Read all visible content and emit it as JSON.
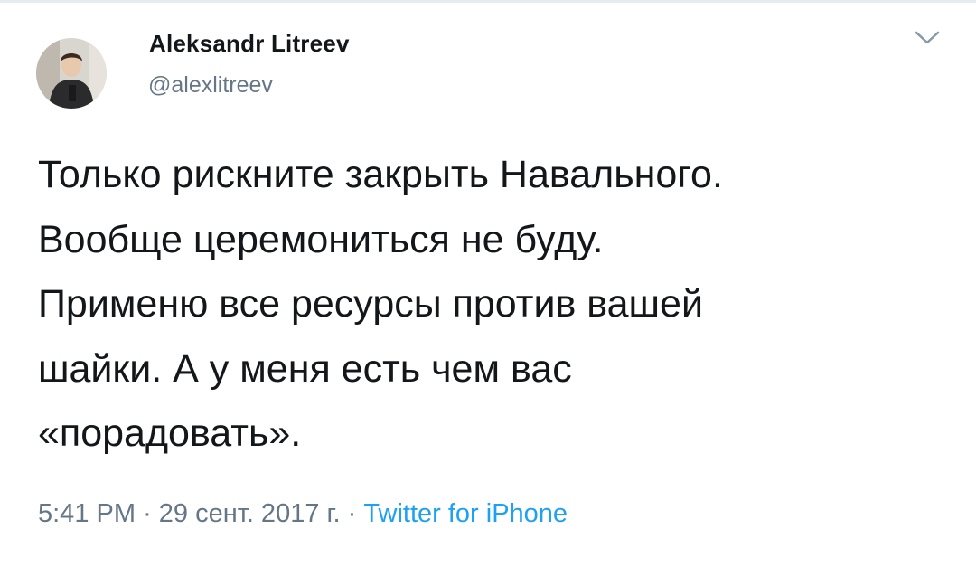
{
  "author": {
    "display_name": "Aleksandr Litreev",
    "handle": "@alexlitreev"
  },
  "tweet": {
    "text": "Только рискните закрыть Навального.\nВообще церемониться не буду.\nПрименю все ресурсы против вашей\nшайки. А у меня есть чем вас\n«порадовать».",
    "time": "5:41 PM",
    "separator1": "·",
    "date": "29 сент. 2017 г.",
    "separator2": "·",
    "source": "Twitter for iPhone"
  },
  "icons": {
    "menu": "chevron-down-icon"
  },
  "colors": {
    "text": "#14171a",
    "secondary": "#657786",
    "link": "#1da1f2",
    "caret": "#8899a6"
  }
}
